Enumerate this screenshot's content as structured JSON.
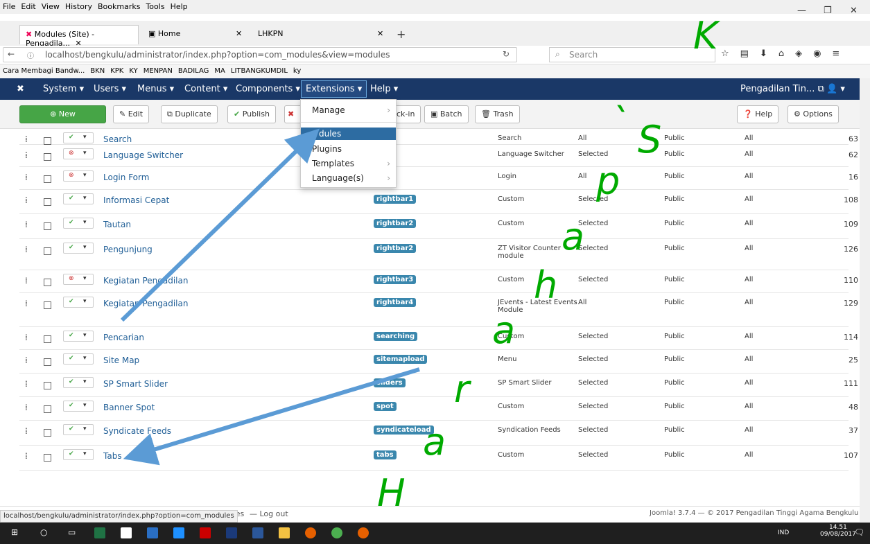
{
  "menubar": [
    "File",
    "Edit",
    "View",
    "History",
    "Bookmarks",
    "Tools",
    "Help"
  ],
  "tabs": [
    {
      "label": "Modules (Site) - Pengadila..."
    },
    {
      "label": "Home"
    },
    {
      "label": "LHKPN"
    }
  ],
  "url": "localhost/bengkulu/administrator/index.php?option=com_modules&view=modules",
  "search_placeholder": "Search",
  "bookmarks": [
    "Cara Membagi Bandw...",
    "BKN",
    "KPK",
    "KY",
    "MENPAN",
    "BADILAG",
    "MA",
    "LITBANGKUMDIL",
    "ky"
  ],
  "jnav": {
    "items": [
      "System",
      "Users",
      "Menus",
      "Content",
      "Components",
      "Extensions",
      "Help"
    ],
    "site": "Pengadilan Tin..."
  },
  "toolbar": {
    "new": "New",
    "edit": "Edit",
    "duplicate": "Duplicate",
    "publish": "Publish",
    "checkin": "ck-in",
    "batch": "Batch",
    "trash": "Trash",
    "help": "Help",
    "options": "Options"
  },
  "dropdown": [
    "Manage",
    "dules",
    "Plugins",
    "Templates",
    "Language(s)"
  ],
  "rows": [
    {
      "title": "Search",
      "pos": "",
      "type": "Search",
      "pages": "All",
      "access": "Public",
      "lang": "All",
      "id": "63",
      "status": "on"
    },
    {
      "title": "Language Switcher",
      "pos": "on-4",
      "type": "Language Switcher",
      "pages": "Selected",
      "access": "Public",
      "lang": "All",
      "id": "62",
      "status": "off"
    },
    {
      "title": "Login Form",
      "pos": "on-7",
      "type": "Login",
      "pages": "All",
      "access": "Public",
      "lang": "All",
      "id": "16",
      "status": "off"
    },
    {
      "title": "Informasi Cepat",
      "pos": "rightbar1",
      "type": "Custom",
      "pages": "Selected",
      "access": "Public",
      "lang": "All",
      "id": "108",
      "status": "on"
    },
    {
      "title": "Tautan",
      "pos": "rightbar2",
      "type": "Custom",
      "pages": "Selected",
      "access": "Public",
      "lang": "All",
      "id": "109",
      "status": "on"
    },
    {
      "title": "Pengunjung",
      "pos": "rightbar2",
      "type": "ZT Visitor Counter module",
      "pages": "Selected",
      "access": "Public",
      "lang": "All",
      "id": "126",
      "status": "on"
    },
    {
      "title": "Kegiatan Pengadilan",
      "pos": "rightbar3",
      "type": "Custom",
      "pages": "Selected",
      "access": "Public",
      "lang": "All",
      "id": "110",
      "status": "off"
    },
    {
      "title": "Kegiatan Pengadilan",
      "pos": "rightbar4",
      "type": "JEvents - Latest Events Module",
      "pages": "All",
      "access": "Public",
      "lang": "All",
      "id": "129",
      "status": "on"
    },
    {
      "title": "Pencarian",
      "pos": "searching",
      "type": "Custom",
      "pages": "Selected",
      "access": "Public",
      "lang": "All",
      "id": "114",
      "status": "on"
    },
    {
      "title": "Site Map",
      "pos": "sitemapload",
      "type": "Menu",
      "pages": "Selected",
      "access": "Public",
      "lang": "All",
      "id": "25",
      "status": "on"
    },
    {
      "title": "SP Smart Slider",
      "pos": "sliders",
      "type": "SP Smart Slider",
      "pages": "Selected",
      "access": "Public",
      "lang": "All",
      "id": "111",
      "status": "on"
    },
    {
      "title": "Banner Spot",
      "pos": "spot",
      "type": "Custom",
      "pages": "Selected",
      "access": "Public",
      "lang": "All",
      "id": "48",
      "status": "on"
    },
    {
      "title": "Syndicate Feeds",
      "pos": "syndicateload",
      "type": "Syndication Feeds",
      "pages": "Selected",
      "access": "Public",
      "lang": "All",
      "id": "37",
      "status": "on"
    },
    {
      "title": "Tabs",
      "pos": "tabs",
      "type": "Custom",
      "pages": "Selected",
      "access": "Public",
      "lang": "All",
      "id": "107",
      "status": "on"
    }
  ],
  "footer": {
    "left": "ages",
    "logout": "Log out",
    "right": "Joomla! 3.7.4 — © 2017 Pengadilan Tinggi Agama Bengkulu"
  },
  "statusurl": "localhost/bengkulu/administrator/index.php?option=com_modules",
  "taskbar": {
    "lang": "IND",
    "time": "14.51",
    "date": "09/08/2017"
  },
  "watermark": [
    "H",
    "a",
    "r",
    "a",
    "h",
    "a",
    "p",
    "`",
    "S",
    "K"
  ]
}
